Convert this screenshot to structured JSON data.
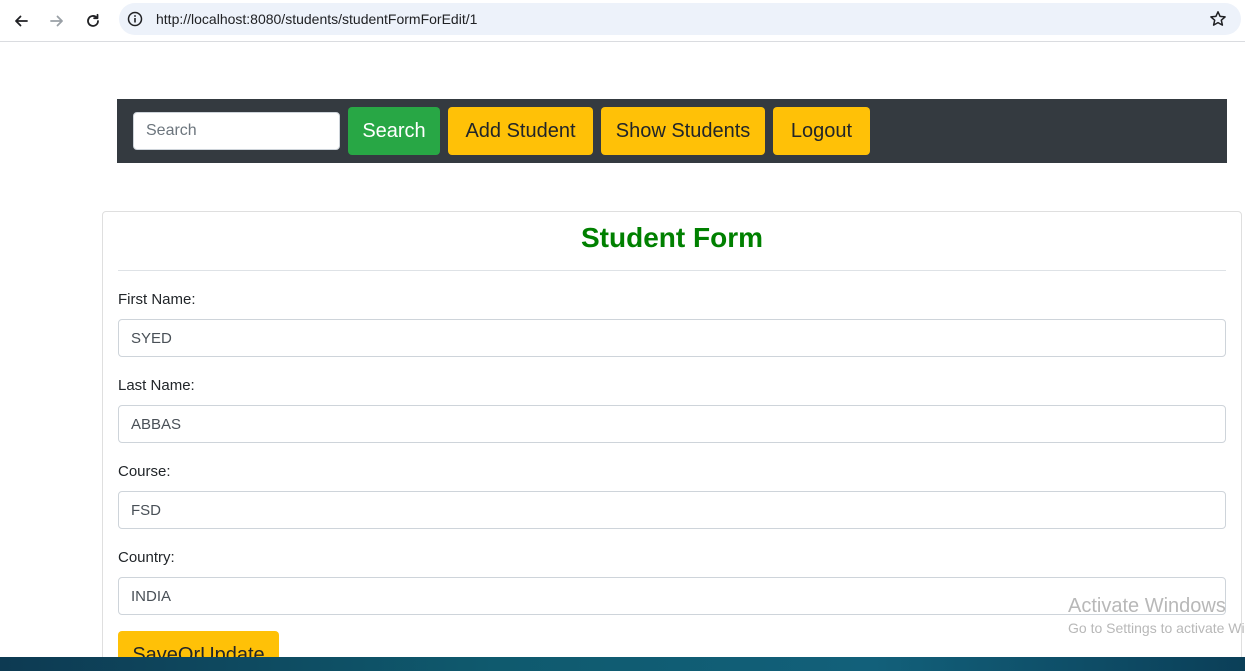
{
  "browser": {
    "url": "http://localhost:8080/students/studentFormForEdit/1",
    "back_icon": "arrow-left-icon",
    "forward_icon": "arrow-right-icon",
    "reload_icon": "reload-icon",
    "info_icon": "info-icon",
    "bookmark_icon": "star-icon"
  },
  "nav": {
    "search_placeholder": "Search",
    "search_button": "Search",
    "add_student": "Add Student",
    "show_students": "Show Students",
    "logout": "Logout"
  },
  "form": {
    "title": "Student Form",
    "fields": [
      {
        "label": "First Name:",
        "value": "SYED"
      },
      {
        "label": "Last Name:",
        "value": "ABBAS"
      },
      {
        "label": "Course:",
        "value": "FSD"
      },
      {
        "label": "Country:",
        "value": "INDIA"
      }
    ],
    "submit_label": "SaveOrUpdate"
  },
  "watermark": {
    "title": "Activate Windows",
    "subtitle": "Go to Settings to activate Windows."
  },
  "colors": {
    "nav_bg": "#343a40",
    "success": "#28a745",
    "warning": "#ffc107",
    "title_green": "#008000"
  }
}
